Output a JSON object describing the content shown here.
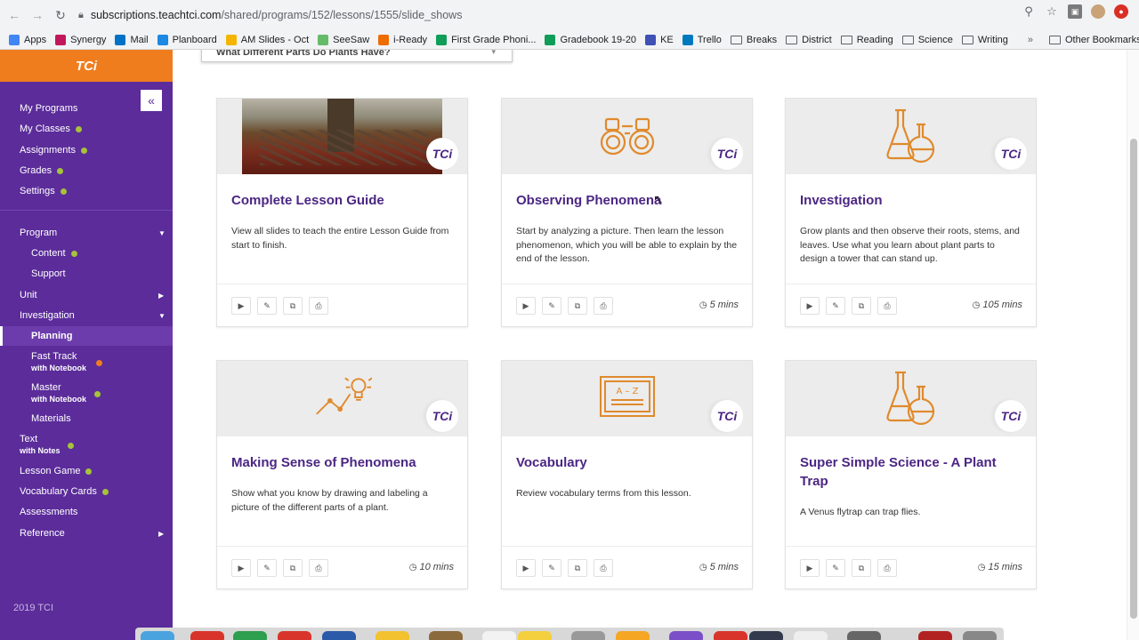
{
  "browser": {
    "url_host": "subscriptions.teachtci.com",
    "url_path": "/shared/programs/152/lessons/1555/slide_shows",
    "bookmarks": [
      {
        "label": "Apps",
        "icon": "apps-grid-icon",
        "color": "#4285f4"
      },
      {
        "label": "Synergy",
        "icon": "synergy-icon",
        "color": "#c2185b"
      },
      {
        "label": "Mail",
        "icon": "outlook-mail-icon",
        "color": "#0072c6"
      },
      {
        "label": "Planboard",
        "icon": "planboard-icon",
        "color": "#1e88e5"
      },
      {
        "label": "AM Slides - Oct",
        "icon": "slides-icon",
        "color": "#f4b400"
      },
      {
        "label": "SeeSaw",
        "icon": "seesaw-icon",
        "color": "#66bb6a"
      },
      {
        "label": "i-Ready",
        "icon": "iready-icon",
        "color": "#ef6c00"
      },
      {
        "label": "First Grade Phoni...",
        "icon": "sheets-icon",
        "color": "#0f9d58"
      },
      {
        "label": "Gradebook 19-20",
        "icon": "sheets-icon",
        "color": "#0f9d58"
      },
      {
        "label": "KE",
        "icon": "ke-icon",
        "color": "#3f51b5"
      },
      {
        "label": "Trello",
        "icon": "trello-icon",
        "color": "#0079bf"
      },
      {
        "label": "Breaks",
        "icon": "folder-icon",
        "color": ""
      },
      {
        "label": "District",
        "icon": "folder-icon",
        "color": ""
      },
      {
        "label": "Reading",
        "icon": "folder-icon",
        "color": ""
      },
      {
        "label": "Science",
        "icon": "folder-icon",
        "color": ""
      },
      {
        "label": "Writing",
        "icon": "folder-icon",
        "color": ""
      }
    ],
    "more_label": "»",
    "other_bookmarks": "Other Bookmarks"
  },
  "sidebar": {
    "logo": "TCi",
    "collapse_glyph": "«",
    "items": {
      "my_programs": "My Programs",
      "my_classes": "My Classes",
      "assignments": "Assignments",
      "grades": "Grades",
      "settings": "Settings",
      "program": "Program",
      "content": "Content",
      "support": "Support",
      "unit": "Unit",
      "investigation": "Investigation",
      "planning": "Planning",
      "fast_track": "Fast Track",
      "fast_track_sub": "with Notebook",
      "master": "Master",
      "master_sub": "with Notebook",
      "materials": "Materials",
      "text": "Text",
      "text_sub": "with Notes",
      "lesson_game": "Lesson Game",
      "vocabulary_cards": "Vocabulary Cards",
      "assessments": "Assessments",
      "reference": "Reference"
    },
    "copyright": "2019 TCI"
  },
  "main": {
    "topcard_text": "What Different Parts Do Plants Have?",
    "badge": "TCi",
    "cards": [
      {
        "title": "Complete Lesson Guide",
        "desc": "View all slides to teach the entire Lesson Guide from start to finish.",
        "duration": ""
      },
      {
        "title": "Observing Phenomena",
        "desc": "Start by analyzing a picture. Then learn the lesson phenomenon, which you will be able to explain by the end of the lesson.",
        "duration": "5 mins"
      },
      {
        "title": "Investigation",
        "desc": "Grow plants and then observe their roots, stems, and leaves. Use what you learn about plant parts to design a tower that can stand up.",
        "duration": "105 mins"
      },
      {
        "title": "Making Sense of Phenomena",
        "desc": "Show what you know by drawing and labeling a picture of the different parts of a plant.",
        "duration": "10 mins"
      },
      {
        "title": "Vocabulary",
        "desc": "Review vocabulary terms from this lesson.",
        "duration": "5 mins"
      },
      {
        "title": "Super Simple Science - A Plant Trap",
        "desc": "A Venus flytrap can trap flies.",
        "duration": "15 mins"
      }
    ],
    "vocab_icon_text": "A – Z"
  },
  "colors": {
    "brand_purple": "#5b2c9a",
    "brand_orange": "#ef7d1e",
    "title_purple": "#4b2683",
    "status_green": "#a6c33a"
  }
}
